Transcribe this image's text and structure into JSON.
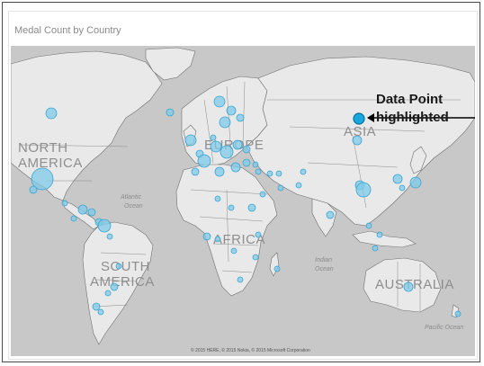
{
  "visual": {
    "title": "Medal Count by Country"
  },
  "map": {
    "continent_labels": {
      "north_america_1": "NORTH",
      "north_america_2": "AMERICA",
      "europe": "EUROPE",
      "asia": "ASIA",
      "africa": "AFRICA",
      "south_america_1": "SOUTH",
      "south_america_2": "AMERICA",
      "australia": "AUSTRALIA"
    },
    "ocean_labels": {
      "atlantic_1": "Atlantic",
      "atlantic_2": "Ocean",
      "indian_1": "Indian",
      "indian_2": "Ocean",
      "pacific": "Pacific Ocean"
    },
    "credit": "© 2015 HERE, © 2015 Nokia, © 2015 Microsoft Corporation",
    "colors": {
      "land": "#e9e9e9",
      "ocean": "#c8c8c8",
      "border": "#6f6f6f",
      "bubble_fill": "#7fcbe8",
      "bubble_stroke": "#3aa4d0",
      "highlight": "#19a7e0"
    }
  },
  "annotation": {
    "line1": "Data Point",
    "line2": "highlighted"
  }
}
